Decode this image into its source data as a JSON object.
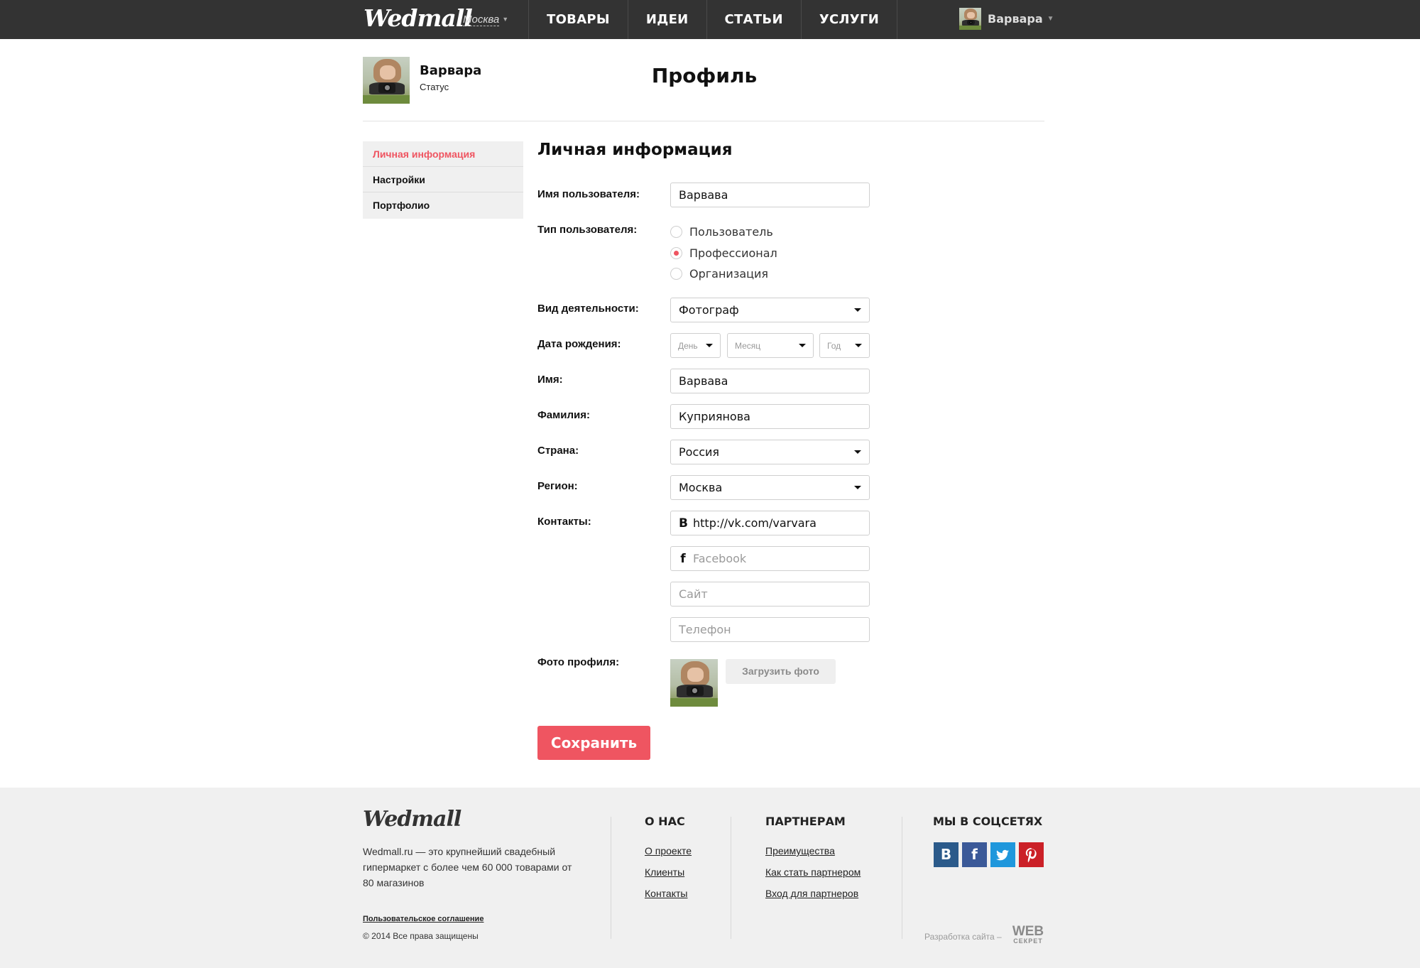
{
  "topbar": {
    "logo": "Wedmall",
    "city": "Москва",
    "nav": [
      "ТОВАРЫ",
      "ИДЕИ",
      "СТАТЬИ",
      "УСЛУГИ"
    ],
    "user_name": "Варвара"
  },
  "profile": {
    "name": "Варвара",
    "status": "Статус",
    "page_title": "Профиль"
  },
  "sidebar": {
    "items": [
      {
        "label": "Личная информация",
        "active": true
      },
      {
        "label": "Настройки",
        "active": false
      },
      {
        "label": "Портфолио",
        "active": false
      }
    ]
  },
  "form": {
    "section_title": "Личная информация",
    "username": {
      "label": "Имя пользователя:",
      "value": "Варвава"
    },
    "user_type": {
      "label": "Тип пользователя:",
      "options": [
        "Пользователь",
        "Профессионал",
        "Организация"
      ],
      "selected": "Профессионал"
    },
    "activity": {
      "label": "Вид деятельности:",
      "value": "Фотограф"
    },
    "birthdate": {
      "label": "Дата рождения:",
      "day": "День",
      "month": "Месяц",
      "year": "Год"
    },
    "first_name": {
      "label": "Имя:",
      "value": "Варвава"
    },
    "last_name": {
      "label": "Фамилия:",
      "value": "Куприянова"
    },
    "country": {
      "label": "Страна:",
      "value": "Россия"
    },
    "region": {
      "label": "Регион:",
      "value": "Москва"
    },
    "contacts": {
      "label": "Контакты:",
      "vk": {
        "icon": "vk-icon",
        "glyph": "B",
        "value": "http://vk.com/varvara"
      },
      "facebook": {
        "icon": "facebook-icon",
        "glyph": "f",
        "placeholder": "Facebook"
      },
      "site": {
        "placeholder": "Сайт"
      },
      "phone": {
        "placeholder": "Телефон"
      }
    },
    "photo": {
      "label": "Фото профиля:",
      "upload_label": "Загрузить фото"
    },
    "save_label": "Сохранить"
  },
  "footer": {
    "logo": "Wedmall",
    "description": "Wedmall.ru — это крупнейший свадебный гипермаркет с более чем 60 000 товарами от 80 магазинов",
    "terms": "Пользовательское соглашение",
    "copyright": "© 2014 Все права защищены",
    "about": {
      "title": "О НАС",
      "links": [
        "О проекте",
        "Клиенты",
        "Контакты"
      ]
    },
    "partners": {
      "title": "ПАРТНЕРАМ",
      "links": [
        "Преимущества",
        "Как стать партнером",
        "Вход для партнеров"
      ]
    },
    "social": {
      "title": "МЫ В СОЦСЕТЯХ",
      "items": [
        {
          "name": "vk-icon",
          "glyph": "B",
          "color": "#2b5a8a"
        },
        {
          "name": "facebook-icon",
          "glyph": "f",
          "color": "#3b5998"
        },
        {
          "name": "twitter-icon",
          "glyph": "t",
          "color": "#1f97dc"
        },
        {
          "name": "pinterest-icon",
          "glyph": "p",
          "color": "#cb2027"
        }
      ]
    },
    "developer": "Разработка сайта –",
    "developer_logo_top": "WEB",
    "developer_logo_bottom": "СЕКРЕТ"
  },
  "colors": {
    "accent": "#ef5561",
    "topbar": "#333333",
    "footer_bg": "#f0f0f0"
  }
}
